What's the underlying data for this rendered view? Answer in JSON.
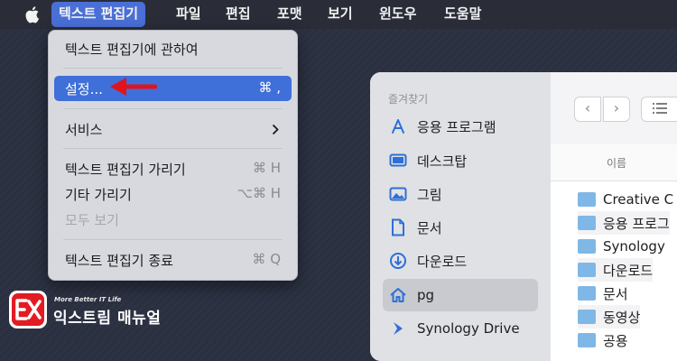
{
  "menubar": {
    "apple_icon": "apple-logo-icon",
    "items": [
      "텍스트 편집기",
      "파일",
      "편집",
      "포맷",
      "보기",
      "윈도우",
      "도움말"
    ]
  },
  "app_menu": {
    "about": "텍스트 편집기에 관하여",
    "settings": {
      "label": "설정...",
      "shortcut": "⌘ ,"
    },
    "services": {
      "label": "서비스",
      "submenu_icon": "chevron-right-icon"
    },
    "hide": {
      "label": "텍스트 편집기 가리기",
      "shortcut": "⌘ H"
    },
    "hide_others": {
      "label": "기타 가리기",
      "shortcut": "⌥⌘ H"
    },
    "show_all": {
      "label": "모두 보기"
    },
    "quit": {
      "label": "텍스트 편집기 종료",
      "shortcut": "⌘ Q"
    }
  },
  "finder": {
    "sidebar_header": "즐겨찾기",
    "sidebar_items": [
      {
        "label": "응용 프로그램",
        "icon": "applications-icon"
      },
      {
        "label": "데스크탑",
        "icon": "desktop-icon"
      },
      {
        "label": "그림",
        "icon": "pictures-icon"
      },
      {
        "label": "문서",
        "icon": "document-icon"
      },
      {
        "label": "다운로드",
        "icon": "downloads-icon"
      },
      {
        "label": "pg",
        "icon": "home-icon"
      },
      {
        "label": "Synology Drive",
        "icon": "synology-drive-icon"
      }
    ],
    "back_label": "‹",
    "forward_label": "›",
    "column_name": "이름",
    "files": [
      "Creative C",
      "응용 프로그",
      "Synology",
      "다운로드",
      "문서",
      "동영상",
      "공용"
    ]
  },
  "logo": {
    "tagline": "More Better IT Life",
    "name": "익스트림 매뉴얼"
  },
  "colors": {
    "highlight": "#3f6fd8",
    "arrow": "#e0141e",
    "folder": "#7fb8e6"
  }
}
